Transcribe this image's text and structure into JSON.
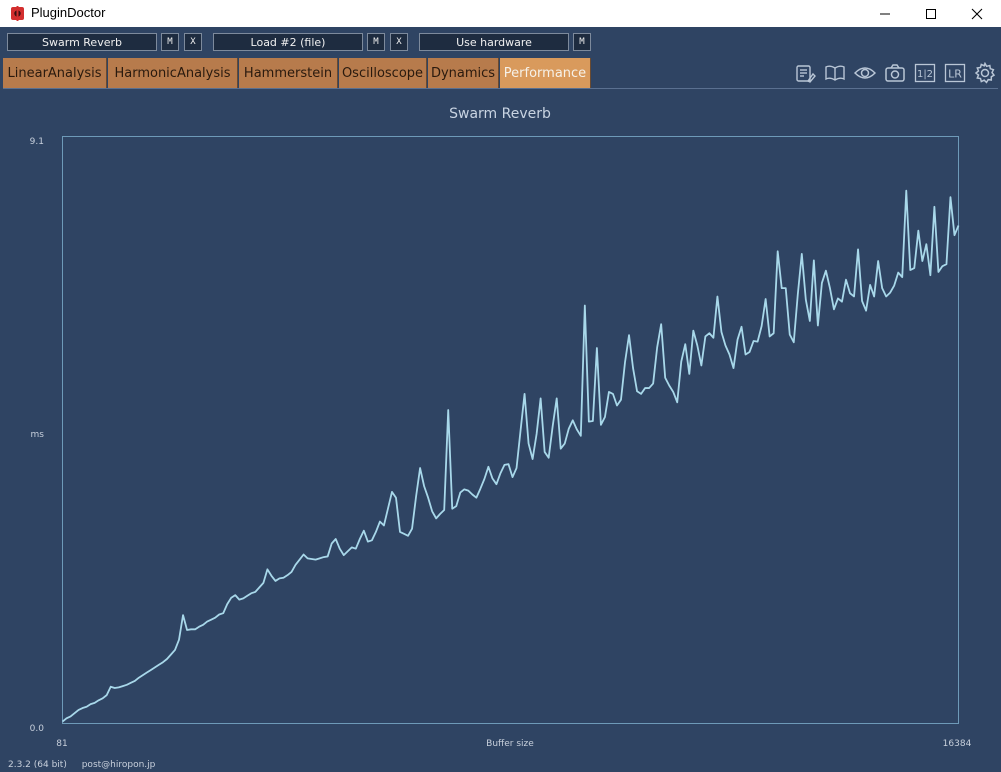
{
  "window": {
    "title": "PluginDoctor"
  },
  "slots": [
    {
      "label": "Swarm Reverb",
      "buttons": [
        "M",
        "X"
      ]
    },
    {
      "label": "Load #2 (file)",
      "buttons": [
        "M",
        "X"
      ]
    },
    {
      "label": "Use hardware",
      "buttons": [
        "M"
      ]
    }
  ],
  "tabs": [
    {
      "label": "LinearAnalysis",
      "active": false
    },
    {
      "label": "HarmonicAnalysis",
      "active": false
    },
    {
      "label": "Hammerstein",
      "active": false
    },
    {
      "label": "Oscilloscope",
      "active": false
    },
    {
      "label": "Dynamics",
      "active": false
    },
    {
      "label": "Performance",
      "active": true
    }
  ],
  "toolbar_icons": [
    "notes-icon",
    "book-icon",
    "eye-icon",
    "camera-icon",
    "one-two-icon",
    "lr-icon",
    "gear-icon"
  ],
  "toolbar_text": {
    "one_two": "1|2",
    "lr": "LR"
  },
  "colors": {
    "background": "#2f4463",
    "tab": "#b77b4c",
    "tab_active": "#d99a5c",
    "line": "#a8d8ea",
    "plot_border": "#6e9ab8"
  },
  "chart_data": {
    "type": "line",
    "title": "Swarm Reverb",
    "xlabel": "Buffer size",
    "ylabel": "ms",
    "xlim": [
      81,
      16384
    ],
    "ylim": [
      0.0,
      9.1
    ],
    "x_tick_labels": [
      "81",
      "16384"
    ],
    "y_tick_labels": [
      "0.0",
      "9.1"
    ],
    "grid": false,
    "series": [
      {
        "values": [
          0.03,
          0.08,
          0.11,
          0.16,
          0.21,
          0.24,
          0.26,
          0.3,
          0.32,
          0.36,
          0.39,
          0.44,
          0.57,
          0.55,
          0.56,
          0.58,
          0.6,
          0.63,
          0.66,
          0.71,
          0.75,
          0.79,
          0.83,
          0.87,
          0.91,
          0.95,
          1.0,
          1.07,
          1.14,
          1.3,
          1.68,
          1.45,
          1.46,
          1.46,
          1.5,
          1.53,
          1.58,
          1.61,
          1.64,
          1.69,
          1.71,
          1.85,
          1.95,
          1.99,
          1.92,
          1.94,
          1.98,
          2.02,
          2.04,
          2.11,
          2.18,
          2.39,
          2.29,
          2.21,
          2.25,
          2.26,
          2.3,
          2.35,
          2.46,
          2.54,
          2.62,
          2.56,
          2.55,
          2.54,
          2.56,
          2.58,
          2.59,
          2.79,
          2.86,
          2.71,
          2.61,
          2.67,
          2.73,
          2.71,
          2.86,
          2.99,
          2.82,
          2.84,
          2.97,
          3.13,
          3.07,
          3.33,
          3.59,
          3.5,
          2.97,
          2.94,
          2.91,
          3.02,
          3.52,
          3.96,
          3.68,
          3.5,
          3.29,
          3.18,
          3.25,
          3.31,
          4.86,
          3.33,
          3.37,
          3.58,
          3.63,
          3.61,
          3.55,
          3.5,
          3.64,
          3.79,
          3.98,
          3.8,
          3.71,
          3.88,
          4.01,
          4.02,
          3.82,
          3.96,
          4.54,
          5.11,
          4.34,
          4.1,
          4.49,
          5.04,
          4.21,
          4.12,
          4.61,
          5.04,
          4.26,
          4.34,
          4.57,
          4.7,
          4.56,
          4.46,
          6.48,
          4.68,
          4.69,
          5.82,
          4.63,
          4.75,
          5.14,
          5.11,
          4.93,
          5.02,
          5.6,
          6.02,
          5.51,
          5.15,
          5.11,
          5.2,
          5.2,
          5.27,
          5.83,
          6.19,
          5.36,
          5.24,
          5.14,
          4.98,
          5.61,
          5.88,
          5.42,
          6.09,
          5.86,
          5.55,
          6.0,
          6.05,
          5.98,
          6.62,
          6.07,
          5.86,
          5.72,
          5.51,
          5.95,
          6.15,
          5.72,
          5.76,
          5.93,
          5.92,
          6.16,
          6.58,
          6.0,
          6.05,
          7.32,
          6.75,
          6.75,
          6.03,
          5.91,
          6.65,
          7.28,
          6.57,
          6.24,
          7.18,
          6.17,
          6.83,
          7.02,
          6.75,
          6.42,
          6.59,
          6.54,
          6.88,
          6.67,
          6.62,
          7.35,
          6.55,
          6.4,
          6.8,
          6.62,
          7.17,
          6.75,
          6.62,
          6.68,
          6.79,
          6.99,
          6.92,
          8.26,
          7.03,
          7.06,
          7.64,
          7.17,
          7.43,
          6.95,
          8.01,
          7.0,
          7.09,
          7.12,
          8.16,
          7.57,
          7.72
        ]
      }
    ]
  },
  "footer": {
    "version": "2.3.2 (64 bit)",
    "email": "post@hiropon.jp"
  }
}
